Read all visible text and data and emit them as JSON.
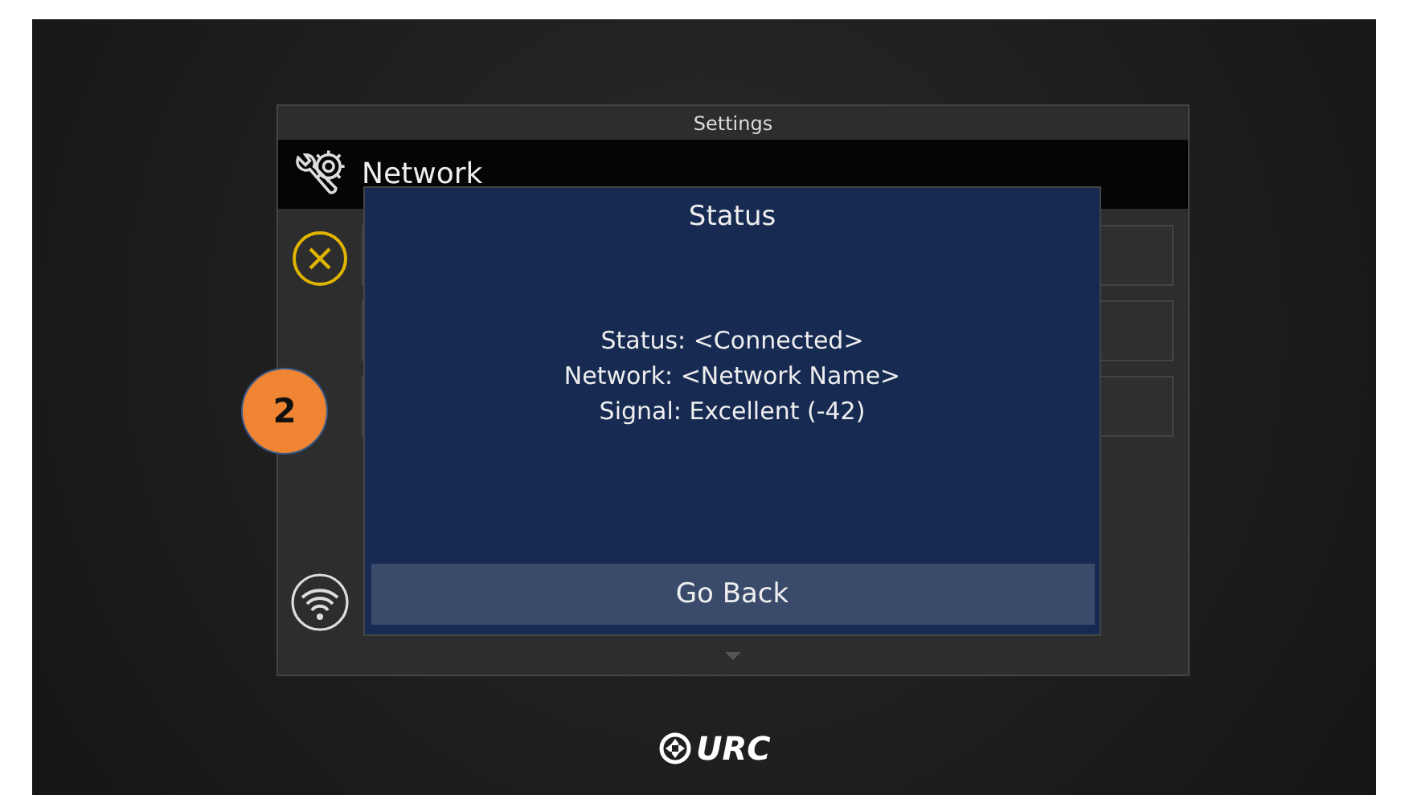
{
  "window": {
    "title": "Settings"
  },
  "header": {
    "title": "Network"
  },
  "dialog": {
    "title": "Status",
    "lines": [
      "Status: <Connected>",
      "Network: <Network Name>",
      "Signal: Excellent (-42)"
    ],
    "button": "Go Back"
  },
  "callout": {
    "label": "2"
  },
  "logo": {
    "text": "URC"
  }
}
